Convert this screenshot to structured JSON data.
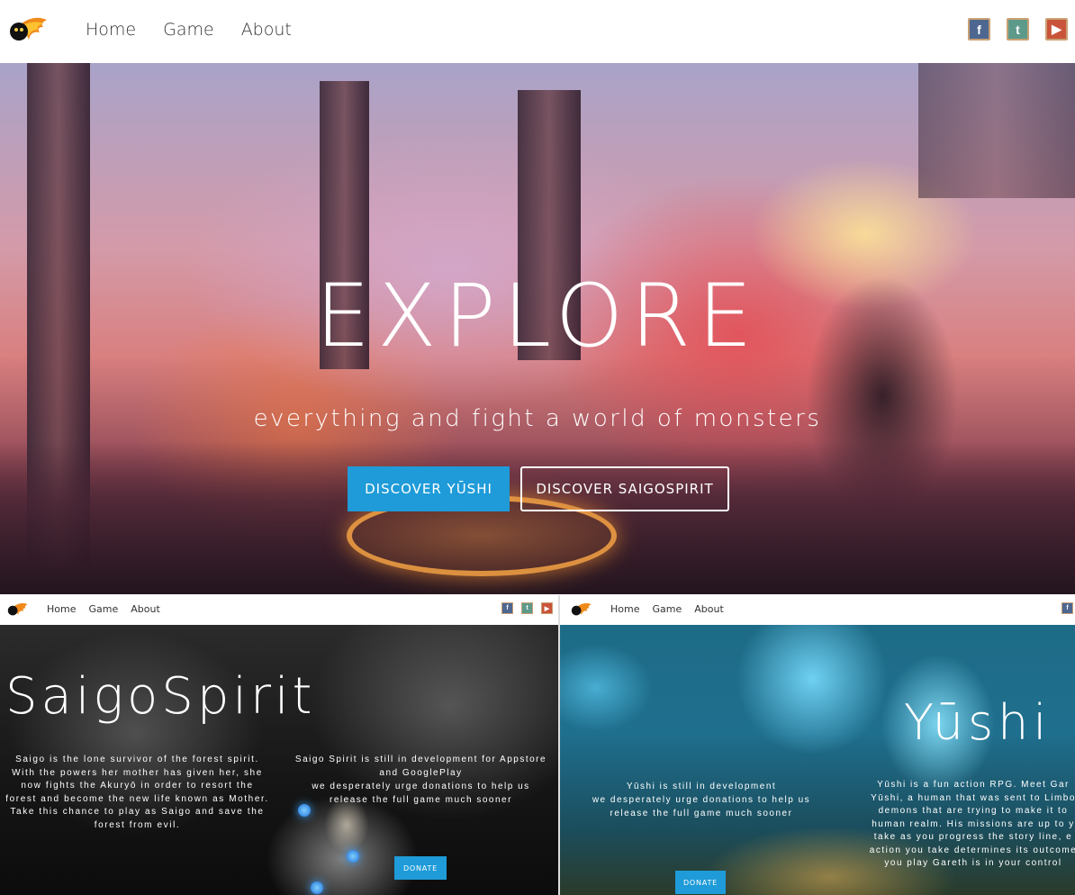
{
  "header": {
    "nav": [
      "Home",
      "Game",
      "About"
    ],
    "social": {
      "facebook": "f",
      "twitter": "t",
      "youtube": "▶"
    }
  },
  "hero": {
    "title": "EXPLORE",
    "subtitle": "everything and fight a world of monsters",
    "btn_primary": "DISCOVER YŪSHI",
    "btn_secondary": "DISCOVER SAIGOSPIRIT"
  },
  "saigo": {
    "nav": [
      "Home",
      "Game",
      "About"
    ],
    "title": "SaigoSpirit",
    "description": "Saigo is the lone survivor of the forest spirit. With the powers her mother has given her, she now fights the Akuryō in order to resort the forest and become the new life known as Mother. Take this chance to play as Saigo and save the forest from evil.",
    "dev_line1": "Saigo Spirit is still in development for Appstore and GooglePlay",
    "dev_line2": "we desperately urge donations to help us release the full game much sooner",
    "donate": "DONATE"
  },
  "yushi": {
    "nav": [
      "Home",
      "Game",
      "About"
    ],
    "title": "Yūshi",
    "dev_line1": "Yūshi is still in development",
    "dev_line2": "we desperately urge donations to help us release the full game much sooner",
    "description": "Yūshi is a fun action RPG. Meet Gar\nYūshi, a human that was sent to Limbo\ndemons that are trying to make it to\nhuman realm. His missions are up to y\ntake as you progress the story line, e\naction you take determines its outcome\nyou play Gareth is in your control",
    "donate": "DONATE"
  },
  "colors": {
    "accent": "#1e9bd8"
  }
}
